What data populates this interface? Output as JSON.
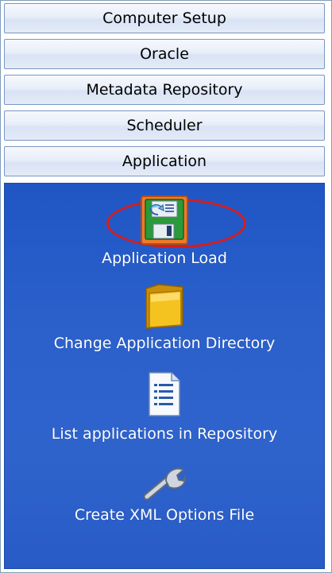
{
  "sections": {
    "computer_setup": "Computer Setup",
    "oracle": "Oracle",
    "metadata_repository": "Metadata Repository",
    "scheduler": "Scheduler",
    "application": "Application"
  },
  "application_items": {
    "application_load": {
      "label": "Application Load",
      "icon": "floppy-disk-icon",
      "highlighted": true,
      "highlight_color": "#d81c1c"
    },
    "change_directory": {
      "label": "Change Application Directory",
      "icon": "folder-icon"
    },
    "list_applications": {
      "label": "List applications in Repository",
      "icon": "document-list-icon"
    },
    "create_xml": {
      "label": "Create XML Options File",
      "icon": "wrench-icon"
    }
  },
  "colors": {
    "panel_blue": "#2b60cb",
    "header_border": "#7a96c4",
    "label_text": "#ffffff"
  }
}
